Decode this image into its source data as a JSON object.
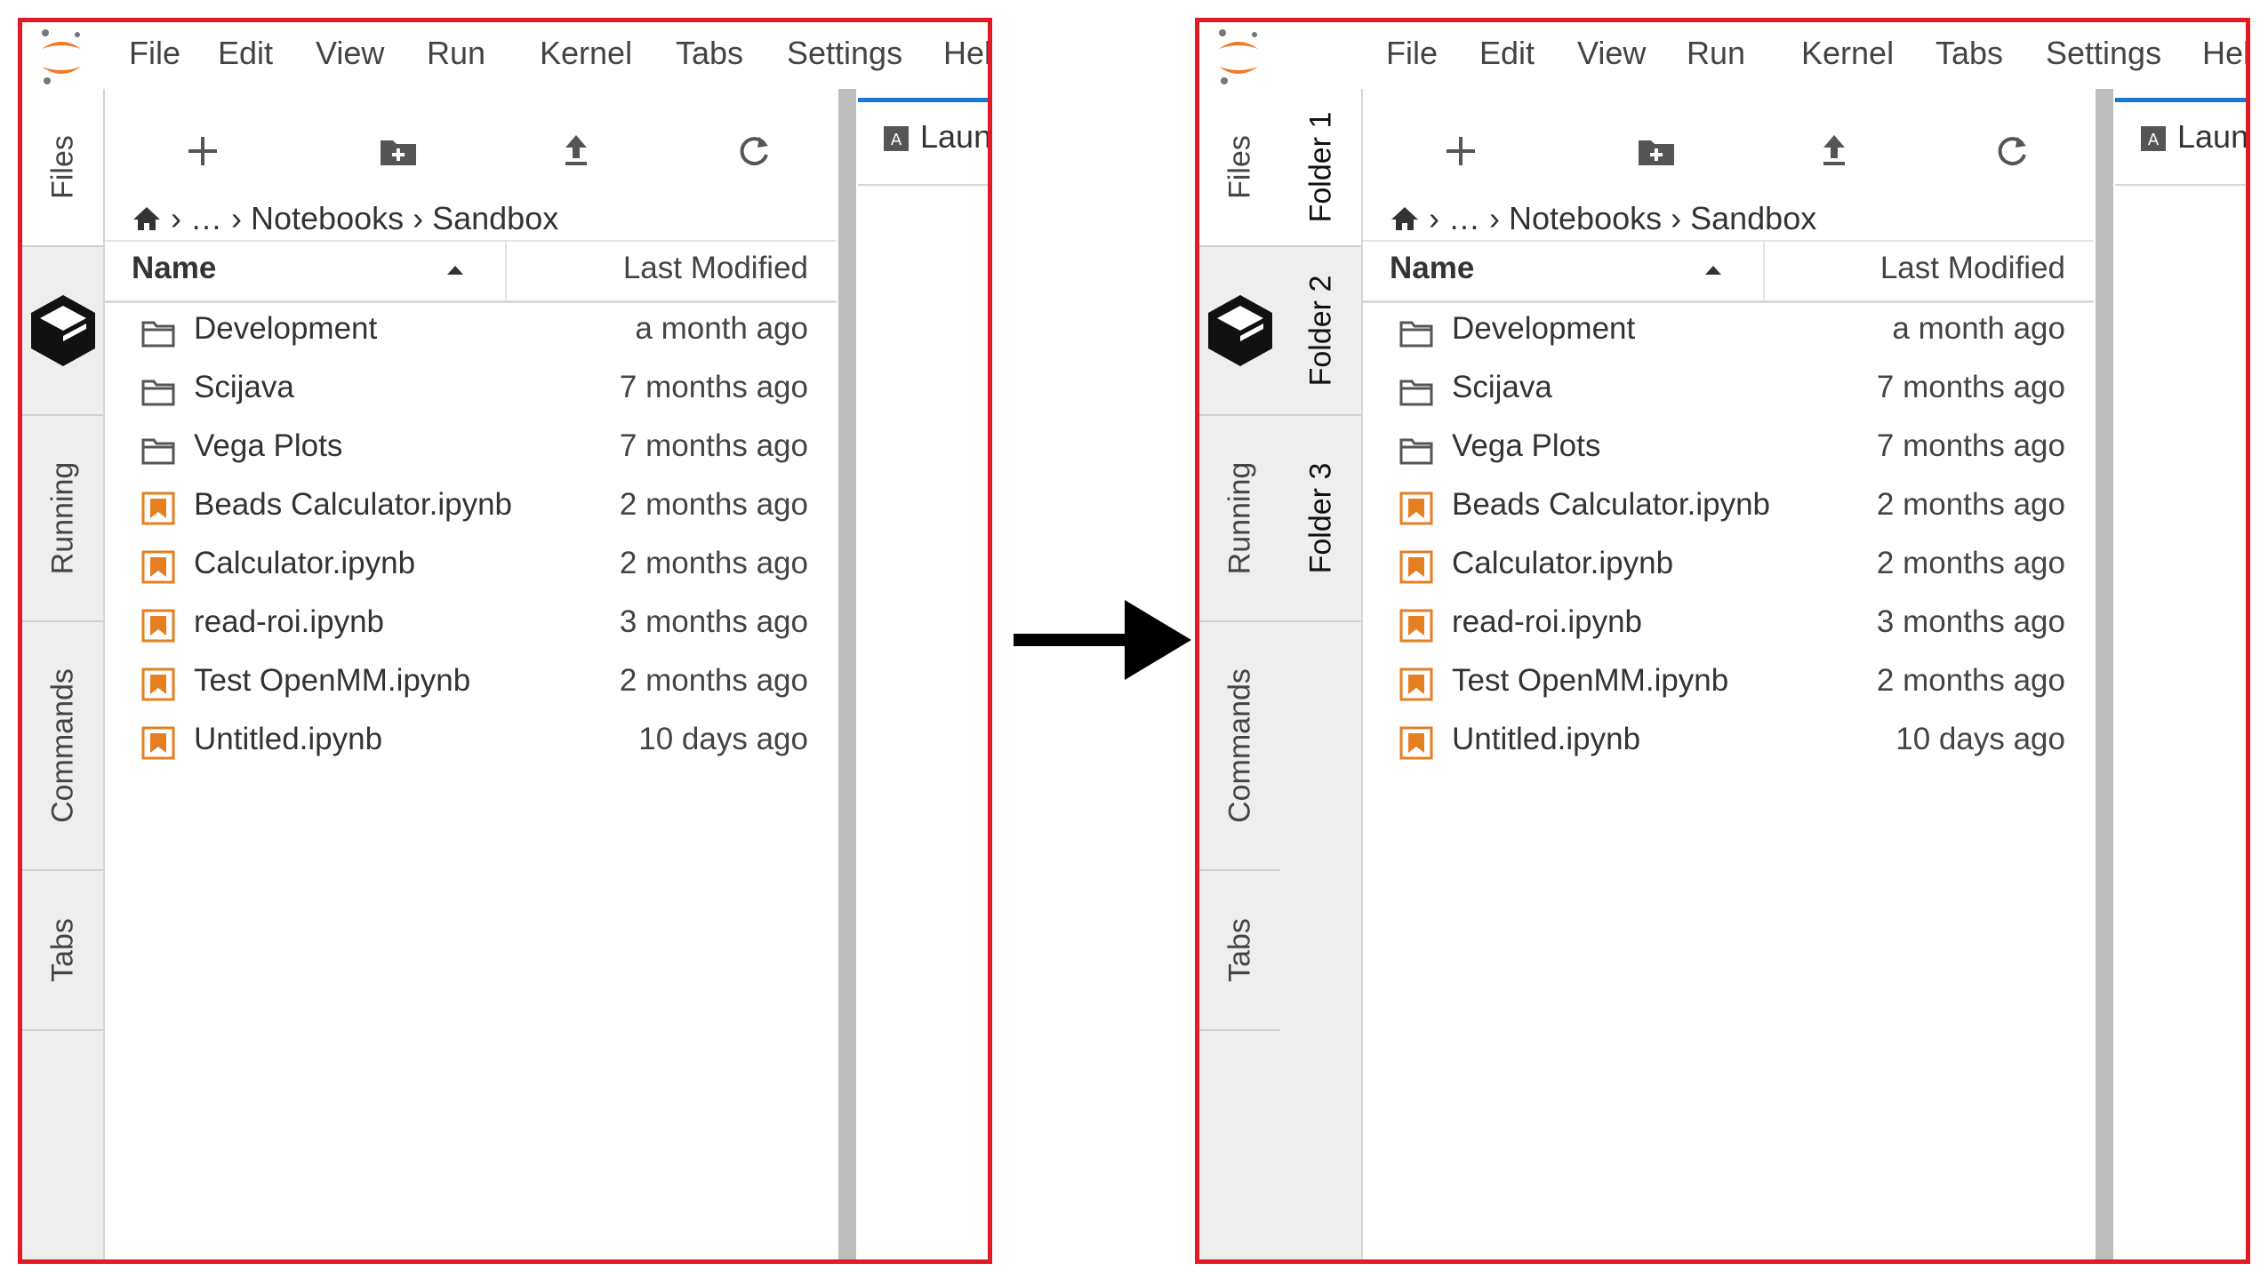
{
  "menu": [
    "File",
    "Edit",
    "View",
    "Run",
    "Kernel",
    "Tabs",
    "Settings",
    "Hel"
  ],
  "sidebar_tabs": [
    "Files",
    "Running",
    "Commands",
    "Tabs"
  ],
  "folder_tabs": [
    "Folder 1",
    "Folder 2",
    "Folder 3"
  ],
  "breadcrumb": {
    "ellipsis": "…",
    "segments": [
      "Notebooks",
      "Sandbox"
    ]
  },
  "columns": {
    "name": "Name",
    "modified": "Last Modified"
  },
  "files": [
    {
      "name": "Development",
      "modified": "a month ago",
      "type": "folder"
    },
    {
      "name": "Scijava",
      "modified": "7 months ago",
      "type": "folder"
    },
    {
      "name": "Vega Plots",
      "modified": "7 months ago",
      "type": "folder"
    },
    {
      "name": "Beads Calculator.ipynb",
      "modified": "2 months ago",
      "type": "notebook"
    },
    {
      "name": "Calculator.ipynb",
      "modified": "2 months ago",
      "type": "notebook"
    },
    {
      "name": "read-roi.ipynb",
      "modified": "3 months ago",
      "type": "notebook"
    },
    {
      "name": "Test OpenMM.ipynb",
      "modified": "2 months ago",
      "type": "notebook"
    },
    {
      "name": "Untitled.ipynb",
      "modified": "10 days ago",
      "type": "notebook"
    }
  ],
  "launcher_tab": "Laun",
  "icons": {
    "new_launcher": "plus-icon",
    "new_folder": "new-folder-icon",
    "upload": "upload-icon",
    "refresh": "refresh-icon",
    "home": "home-icon",
    "folder": "folder-icon",
    "notebook": "notebook-icon",
    "sort": "sort-ascending-icon"
  },
  "colors": {
    "frame": "#e01b24",
    "notebook_icon": "#e67e22",
    "active_tab_accent": "#1976d2"
  }
}
